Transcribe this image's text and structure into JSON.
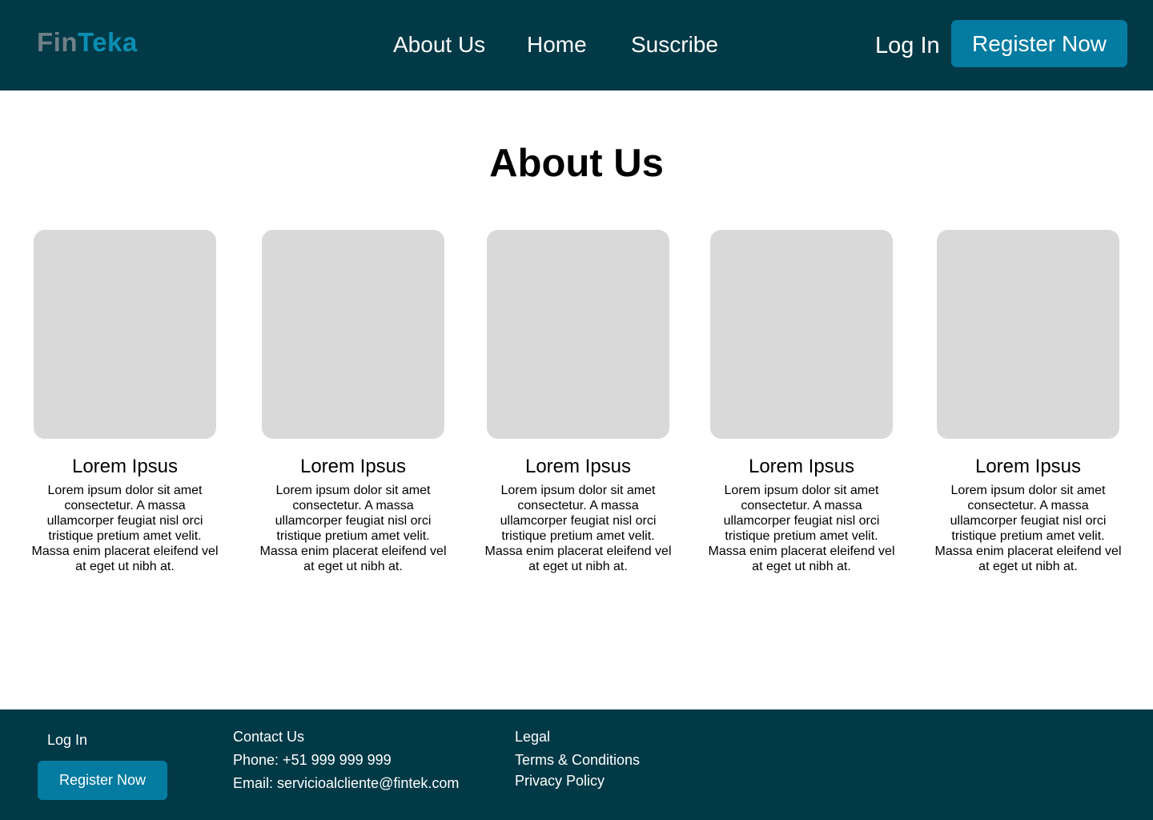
{
  "header": {
    "logo": {
      "part1": "Fin",
      "part2": "Teka"
    },
    "nav": [
      {
        "label": "About Us"
      },
      {
        "label": "Home"
      },
      {
        "label": "Suscribe"
      }
    ],
    "login_label": "Log In",
    "register_label": "Register Now"
  },
  "main": {
    "title": "About Us",
    "cards": [
      {
        "title": "Lorem Ipsus",
        "description": "Lorem ipsum dolor sit amet consectetur. A massa ullamcorper feugiat nisl orci tristique pretium amet velit. Massa enim placerat eleifend vel at eget ut nibh at."
      },
      {
        "title": "Lorem Ipsus",
        "description": "Lorem ipsum dolor sit amet consectetur. A massa ullamcorper feugiat nisl orci tristique pretium amet velit. Massa enim placerat eleifend vel at eget ut nibh at."
      },
      {
        "title": "Lorem Ipsus",
        "description": "Lorem ipsum dolor sit amet consectetur. A massa ullamcorper feugiat nisl orci tristique pretium amet velit. Massa enim placerat eleifend vel at eget ut nibh at."
      },
      {
        "title": "Lorem Ipsus",
        "description": "Lorem ipsum dolor sit amet consectetur. A massa ullamcorper feugiat nisl orci tristique pretium amet velit. Massa enim placerat eleifend vel at eget ut nibh at."
      },
      {
        "title": "Lorem Ipsus",
        "description": "Lorem ipsum dolor sit amet consectetur. A massa ullamcorper feugiat nisl orci tristique pretium amet velit. Massa enim placerat eleifend vel at eget ut nibh at."
      }
    ]
  },
  "footer": {
    "login_label": "Log In",
    "register_label": "Register Now",
    "contact": {
      "heading": "Contact Us",
      "phone": "Phone: +51 999 999 999",
      "email": "Email: servicioalcliente@fintek.com"
    },
    "legal": {
      "heading": "Legal",
      "terms": "Terms & Conditions",
      "privacy": "Privacy Policy"
    }
  },
  "colors": {
    "header_bg": "#013946",
    "accent": "#047ba0",
    "logo_gray": "#6f8088",
    "logo_teal": "#0a8fb2",
    "placeholder": "#d9d9d9"
  }
}
